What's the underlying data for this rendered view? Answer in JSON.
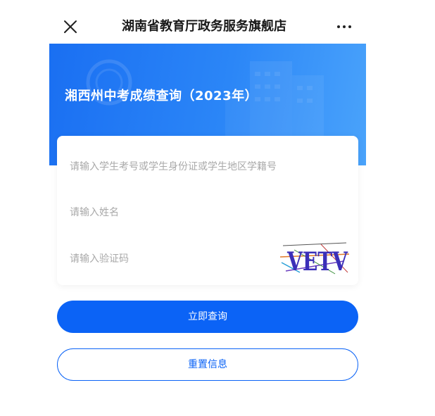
{
  "header": {
    "title": "湖南省教育厅政务服务旗舰店",
    "close_icon": "close-icon",
    "more_icon": "more-horizontal-icon"
  },
  "banner": {
    "title": "湘西州中考成绩查询（2023年）"
  },
  "form": {
    "id_placeholder": "请输入学生考号或学生身份证或学生地区学籍号",
    "name_placeholder": "请输入姓名",
    "captcha_placeholder": "请输入验证码",
    "captcha_text": "VETV"
  },
  "actions": {
    "submit_label": "立即查询",
    "reset_label": "重置信息"
  },
  "colors": {
    "primary": "#0b63f6",
    "banner_start": "#1a6ff2",
    "banner_end": "#4aa3fb"
  }
}
